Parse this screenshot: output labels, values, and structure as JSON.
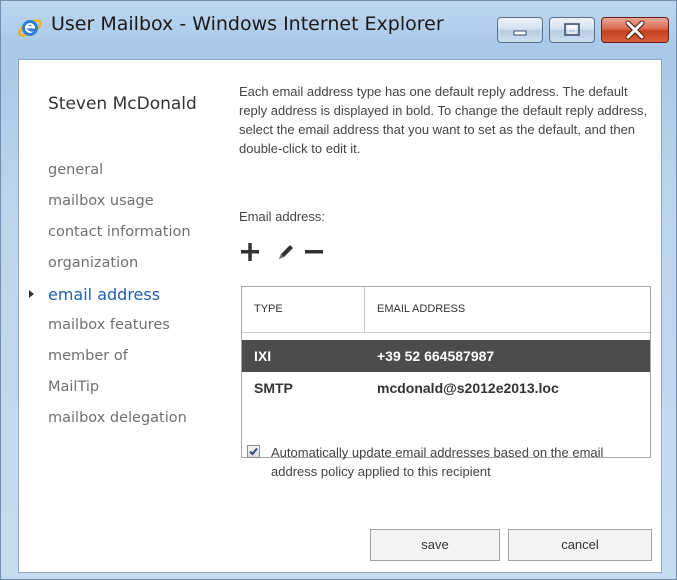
{
  "window": {
    "title": "User Mailbox - Windows Internet Explorer",
    "app_icon": "internet-explorer-icon",
    "controls": {
      "minimize_icon": "minimize-icon",
      "maximize_icon": "maximize-icon",
      "close_icon": "close-icon"
    }
  },
  "user": {
    "display_name": "Steven McDonald"
  },
  "nav": {
    "items": [
      {
        "label": "general",
        "active": false
      },
      {
        "label": "mailbox usage",
        "active": false
      },
      {
        "label": "contact information",
        "active": false
      },
      {
        "label": "organization",
        "active": false
      },
      {
        "label": "email address",
        "active": true
      },
      {
        "label": "mailbox features",
        "active": false
      },
      {
        "label": "member of",
        "active": false
      },
      {
        "label": "MailTip",
        "active": false
      },
      {
        "label": "mailbox delegation",
        "active": false
      }
    ]
  },
  "content": {
    "help_text": "Each email address type has one default reply address. The default reply address is displayed in bold. To change the default reply address, select the email address that you want to set as the default, and then double-click to edit it.",
    "email_label": "Email address:",
    "toolbar": {
      "add_icon": "plus-icon",
      "edit_icon": "pencil-icon",
      "remove_icon": "minus-icon"
    },
    "table": {
      "columns": [
        "TYPE",
        "EMAIL ADDRESS"
      ],
      "rows": [
        {
          "type": "IXI",
          "address": "+39 52 664587987",
          "selected": true
        },
        {
          "type": "SMTP",
          "address": "mcdonald@s2012e2013.loc",
          "selected": false
        }
      ]
    },
    "auto_update": {
      "checked": true,
      "label": "Automatically update email addresses based on the email address policy applied to this recipient"
    },
    "buttons": {
      "save": "save",
      "cancel": "cancel"
    }
  },
  "colors": {
    "accent": "#1e5fae",
    "selected_row": "#4c4c4c",
    "close_button": "#c2401f"
  }
}
